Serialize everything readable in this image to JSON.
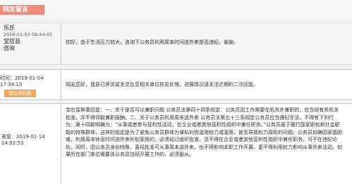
{
  "header": {
    "badge": "网友留言"
  },
  "question": {
    "author": "乐乐",
    "time": "2019-01-03 09:44:02",
    "place": "宝应县",
    "type": "咨询",
    "content": "你好，由于生活压力较大，咨询下公务员利用周末时间送外卖是否违纪，谢谢。"
  },
  "reply1": {
    "time_label": "时间：2019-01-04 17:34:15",
    "department": "宝应县纪委",
    "content": "网友您好，我县已将该留言交办至相关单位核实处理，进展情况请关注近期的二次回复。"
  },
  "reply2": {
    "time_label": "答复：2019-01-14 14:52:53",
    "content": "宝应监察委回复：一、关于是否可以兼职问题 公务员法第四十四条规定：公务员因工作需要在机关外兼职的，应当经有关机关批准，并不得领取兼职报酬。二、关于公务员利用周末送外卖 公务员法第五十三条规定公务员应当遵纪守法，不得有下列行为：第十四款明确为：“从事或者参与营利性活动，在企业或者其他营利性组织中兼任职务。”公务员属于履行国家职权和社会职能的特殊群体，这样的规定是为了避免公务员群体为谋私利而滥用权力或滥用，甚至导致权力腐败的问题。公务员如确因家庭困难，利用周末休息时间送外卖补贴家用的，必须经过组织批准，且不得在企业或者其他营利性组织中兼任职务，可不在违纪论处。同时，因公务员身份特殊，虽经批准可从事周末送外卖，也不得影响本职工作开展，更不得利用权力影响从事外卖活动。如果所在部门单位需要该公务员加班开展工作的，必须服从。"
  }
}
